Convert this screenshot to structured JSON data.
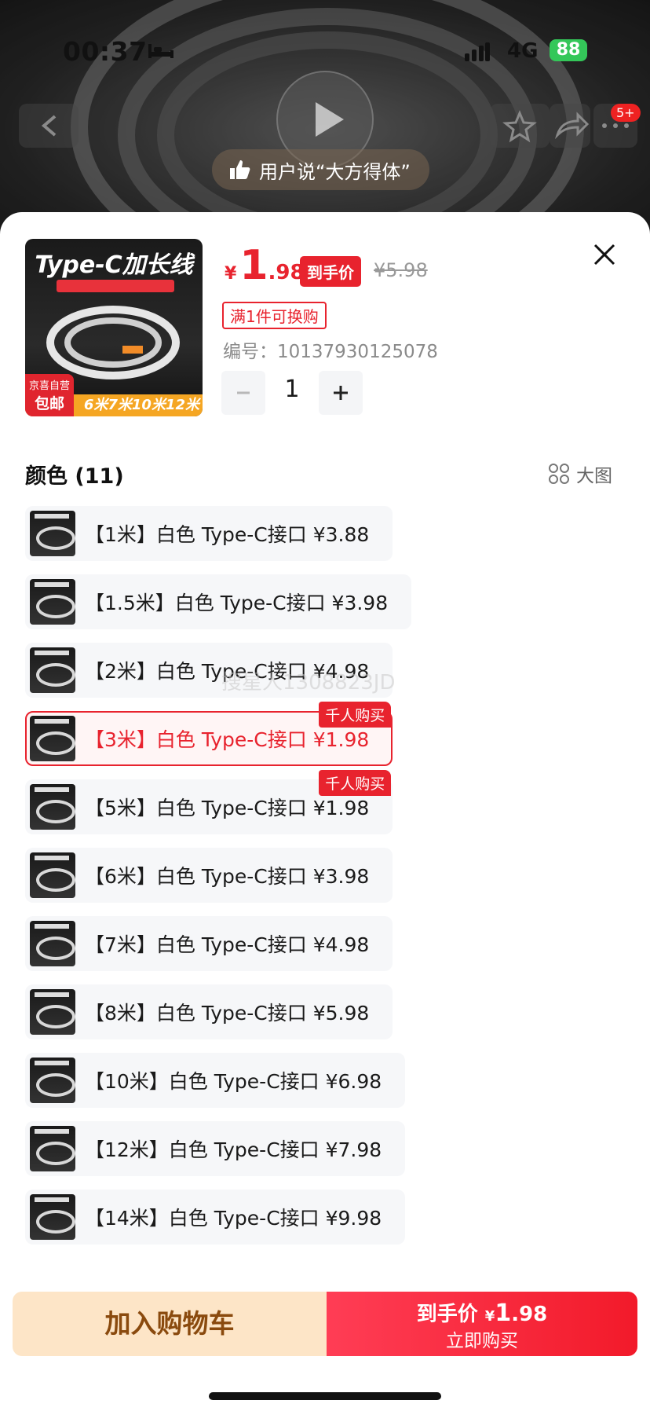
{
  "status": {
    "time": "00:37",
    "network": "4G",
    "battery": "88"
  },
  "nav": {
    "more_badge": "5+"
  },
  "banner": {
    "review_text": "用户说“大方得体”"
  },
  "product": {
    "thumb_title": "Type-C加长线",
    "thumb_strip": "6米7米10米12米",
    "jd_tag_line1": "京喜自营",
    "jd_tag_line2": "包邮",
    "currency": "¥",
    "price_int": "1",
    "price_dec": ".98",
    "price_tag": "到手价",
    "original_price": "¥5.98",
    "promo": "满1件可换购",
    "sku_label": "编号：",
    "sku": "10137930125078",
    "quantity": "1"
  },
  "colors": {
    "title": "颜色 (11)",
    "big_image": "大图",
    "options": [
      {
        "label": "【1米】白色 Type-C接口   ¥3.88",
        "badge": ""
      },
      {
        "label": "【1.5米】白色 Type-C接口   ¥3.98",
        "badge": ""
      },
      {
        "label": "【2米】白色 Type-C接口   ¥4.98",
        "badge": ""
      },
      {
        "label": "【3米】白色 Type-C接口   ¥1.98",
        "badge": "千人购买"
      },
      {
        "label": "【5米】白色 Type-C接口   ¥1.98",
        "badge": "千人购买"
      },
      {
        "label": "【6米】白色 Type-C接口   ¥3.98",
        "badge": ""
      },
      {
        "label": "【7米】白色 Type-C接口   ¥4.98",
        "badge": ""
      },
      {
        "label": "【8米】白色 Type-C接口   ¥5.98",
        "badge": ""
      },
      {
        "label": "【10米】白色 Type-C接口   ¥6.98",
        "badge": ""
      },
      {
        "label": "【12米】白色 Type-C接口   ¥7.98",
        "badge": ""
      },
      {
        "label": "【14米】白色 Type-C接口   ¥9.98",
        "badge": ""
      }
    ],
    "selected_index": 3
  },
  "watermark": "搜星人1308823JD",
  "actions": {
    "add_to_cart": "加入购物车",
    "buy_price_label": "到手价",
    "buy_currency": "¥",
    "buy_price_int": "1",
    "buy_price_dec": ".98",
    "buy_now": "立即购买"
  },
  "theme": {
    "accent": "#e8232e",
    "cart_bg": "#fde5c7",
    "cart_text": "#8a4a0e"
  }
}
